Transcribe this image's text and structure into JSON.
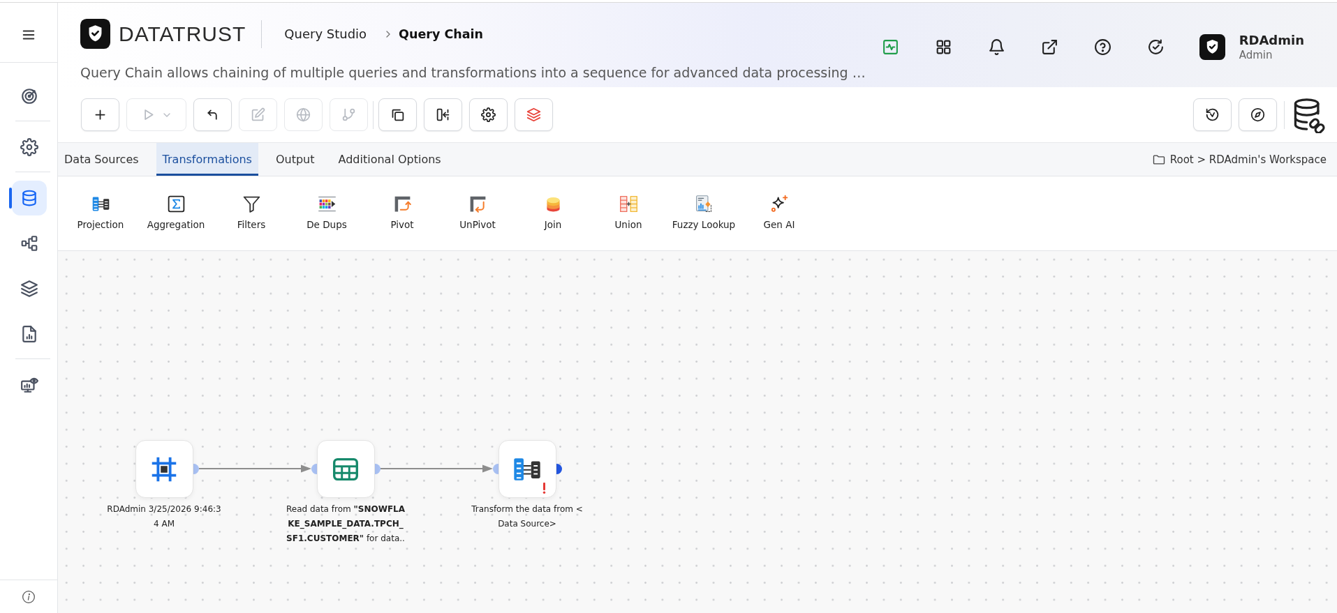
{
  "sidebar": {
    "groups": [
      {
        "items": [
          {
            "kind": "target",
            "selected": false
          }
        ]
      },
      {
        "items": [
          {
            "kind": "settings",
            "selected": false
          }
        ]
      },
      {
        "items": [
          {
            "kind": "database",
            "selected": true
          },
          {
            "kind": "flow",
            "selected": false
          },
          {
            "kind": "layers",
            "selected": false
          },
          {
            "kind": "report",
            "selected": false
          }
        ]
      },
      {
        "items": [
          {
            "kind": "monitor",
            "selected": false
          }
        ]
      }
    ]
  },
  "header": {
    "brand": "DATATRUST",
    "breadcrumb": [
      {
        "label": "Query Studio",
        "current": false
      },
      {
        "label": "Query Chain",
        "current": true
      }
    ],
    "description": "Query Chain allows chaining of multiple queries and transformations into a sequence for advanced data processing …",
    "user": {
      "name": "RDAdmin",
      "role": "Admin"
    }
  },
  "toolbar": {
    "left_groups": [
      {
        "buttons": [
          {
            "kind": "add",
            "disabled": false
          },
          {
            "kind": "run",
            "disabled": true
          },
          {
            "kind": "undo",
            "disabled": false
          },
          {
            "kind": "edit",
            "disabled": true
          },
          {
            "kind": "globe",
            "disabled": true
          },
          {
            "kind": "branch",
            "disabled": true
          }
        ]
      },
      {
        "buttons": [
          {
            "kind": "copy",
            "disabled": false
          },
          {
            "kind": "split",
            "disabled": false
          },
          {
            "kind": "settings",
            "disabled": false
          },
          {
            "kind": "layers",
            "disabled": false
          }
        ]
      }
    ],
    "right_groups": [
      {
        "buttons": [
          {
            "kind": "history",
            "disabled": false
          },
          {
            "kind": "compass",
            "disabled": false
          }
        ]
      },
      {
        "buttons": [
          {
            "kind": "database-link",
            "disabled": false
          }
        ]
      }
    ]
  },
  "tabs": [
    {
      "label": "Data Sources",
      "selected": false
    },
    {
      "label": "Transformations",
      "selected": true
    },
    {
      "label": "Output",
      "selected": false
    },
    {
      "label": "Additional Options",
      "selected": false
    }
  ],
  "location": "Root > RDAdmin's Workspace",
  "palette": [
    {
      "kind": "projection",
      "label": "Projection"
    },
    {
      "kind": "aggregation",
      "label": "Aggregation"
    },
    {
      "kind": "filters",
      "label": "Filters"
    },
    {
      "kind": "dedups",
      "label": "De Dups"
    },
    {
      "kind": "pivot",
      "label": "Pivot"
    },
    {
      "kind": "unpivot",
      "label": "UnPivot"
    },
    {
      "kind": "join",
      "label": "Join"
    },
    {
      "kind": "union",
      "label": "Union"
    },
    {
      "kind": "fuzzy",
      "label": "Fuzzy Lookup"
    },
    {
      "kind": "genai",
      "label": "Gen AI"
    }
  ],
  "canvas": {
    "nodes": [
      {
        "kind": "source",
        "label": "RDAdmin 3/25/2026 9:46:34 AM",
        "output_connected": true,
        "warning": false
      },
      {
        "kind": "table",
        "label": "Read data from **\"SNOWFLAKE_SAMPLE_DATA.TPCH_SF1.CUSTOMER\"** for data..",
        "output_connected": true,
        "warning": false
      },
      {
        "kind": "projection",
        "label": "Transform the data from <Data Source>",
        "output_connected": false,
        "warning": true
      }
    ]
  }
}
